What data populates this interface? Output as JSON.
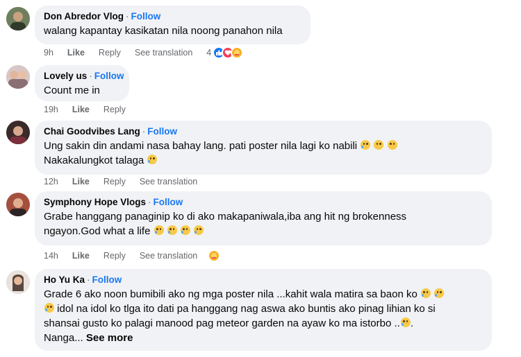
{
  "comments": [
    {
      "name": "Don Abredor Vlog",
      "follow": "Follow",
      "lines": [
        "walang kapantay kasikatan nila noong panahon nila"
      ],
      "time": "9h",
      "like": "Like",
      "reply": "Reply",
      "translate": "See translation",
      "reaction_count": "4"
    },
    {
      "name": "Lovely us",
      "follow": "Follow",
      "lines": [
        "Count me in"
      ],
      "time": "19h",
      "like": "Like",
      "reply": "Reply"
    },
    {
      "name": "Chai Goodvibes Lang",
      "follow": "Follow",
      "lines": [
        "Ung sakin din andami nasa bahay lang. pati poster nila lagi ko nabili",
        "Nakakalungkot talaga"
      ],
      "time": "12h",
      "like": "Like",
      "reply": "Reply",
      "translate": "See translation"
    },
    {
      "name": "Symphony Hope Vlogs",
      "follow": "Follow",
      "lines": [
        "Grabe hanggang panaginip ko di ako makapaniwala,iba ang hit ng brokenness",
        "ngayon.God what a life"
      ],
      "time": "14h",
      "like": "Like",
      "reply": "Reply",
      "translate": "See translation"
    },
    {
      "name": "Ho Yu Ka",
      "follow": "Follow",
      "lines": [
        "Grade 6 ako noon bumibili ako ng mga poster nila ...kahit wala matira sa baon ko",
        "idol na idol ko tlga ito dati pa hanggang nag aswa ako buntis ako pinag lihian ko si",
        "shansai gusto ko palagi manood pag meteor garden na ayaw ko ma istorbo ..",
        "Nanga..."
      ],
      "see_more": "See more"
    }
  ],
  "colors": {
    "bubble": "#f0f2f5",
    "link": "#1877f2",
    "meta": "#65676b"
  }
}
